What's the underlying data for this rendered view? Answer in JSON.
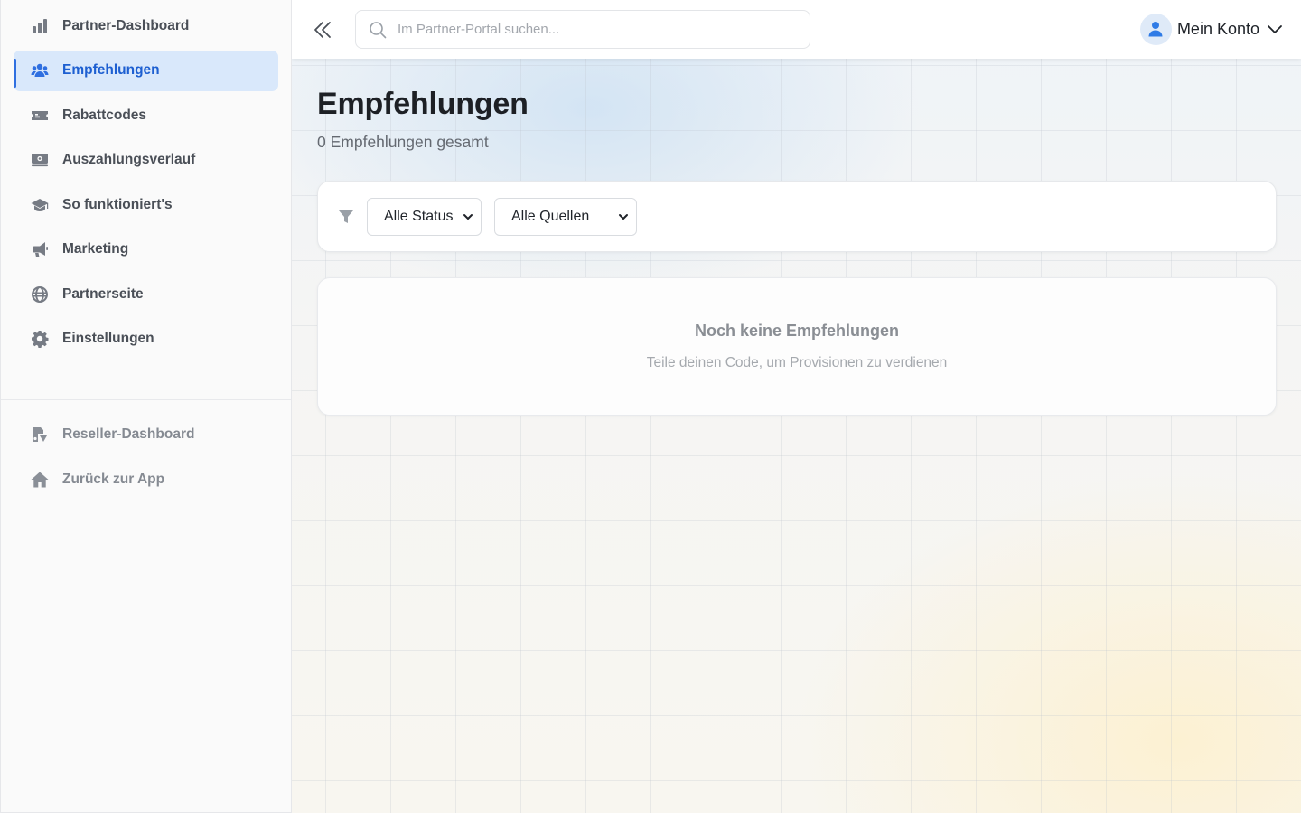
{
  "sidebar": {
    "items": [
      {
        "label": "Partner-Dashboard",
        "icon": "bar-chart-icon",
        "active": false
      },
      {
        "label": "Empfehlungen",
        "icon": "users-icon",
        "active": true
      },
      {
        "label": "Rabattcodes",
        "icon": "ticket-icon",
        "active": false
      },
      {
        "label": "Auszahlungsverlauf",
        "icon": "money-bill-icon",
        "active": false
      },
      {
        "label": "So funktioniert's",
        "icon": "graduation-cap-icon",
        "active": false
      },
      {
        "label": "Marketing",
        "icon": "megaphone-icon",
        "active": false
      },
      {
        "label": "Partnerseite",
        "icon": "globe-icon",
        "active": false
      },
      {
        "label": "Einstellungen",
        "icon": "gear-icon",
        "active": false
      }
    ],
    "secondary_items": [
      {
        "label": "Reseller-Dashboard",
        "icon": "reseller-icon"
      },
      {
        "label": "Zurück zur App",
        "icon": "home-icon"
      }
    ]
  },
  "header": {
    "search_placeholder": "Im Partner-Portal suchen...",
    "account_label": "Mein Konto"
  },
  "main": {
    "title": "Empfehlungen",
    "subtitle": "0 Empfehlungen gesamt",
    "filters": {
      "status_selected": "Alle Status",
      "source_selected": "Alle Quellen"
    },
    "empty_state": {
      "title": "Noch keine Empfehlungen",
      "text": "Teile deinen Code, um Provisionen zu verdienen"
    }
  },
  "colors": {
    "accent": "#2f6fe0",
    "active_bg": "#d9e8fb",
    "active_text": "#1d5fd1"
  }
}
